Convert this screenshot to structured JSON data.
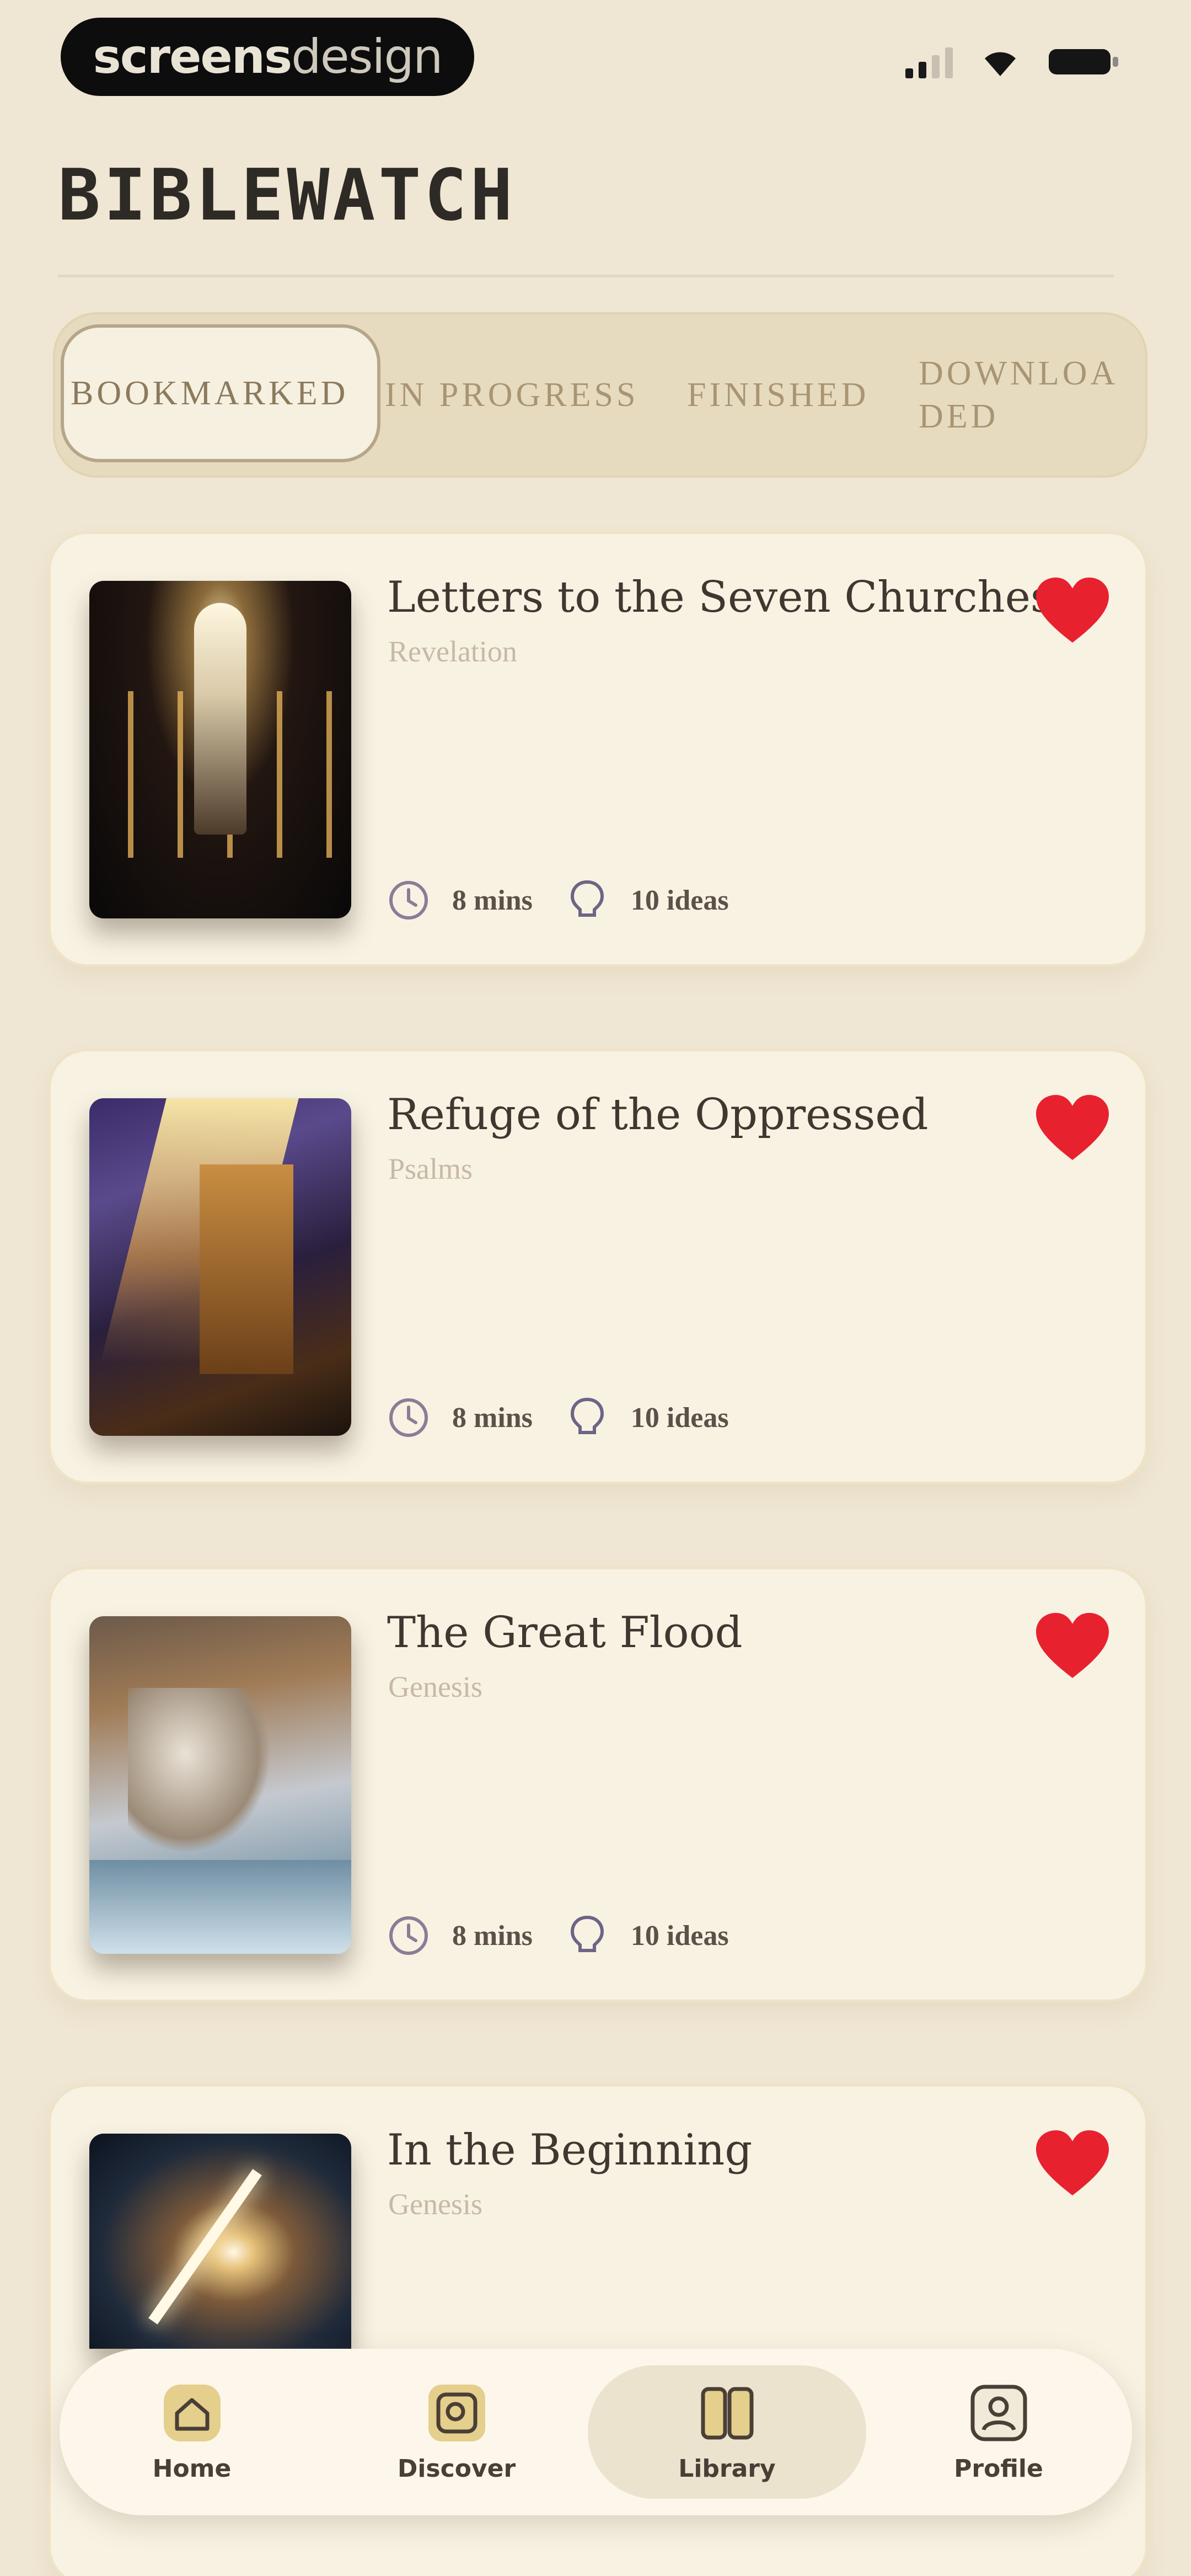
{
  "status_bar": {
    "brand_bold": "screens",
    "brand_light": "design",
    "icons": [
      "signal-icon",
      "wifi-icon",
      "battery-icon"
    ]
  },
  "header": {
    "title": "BIBLEWATCH"
  },
  "tabs": [
    {
      "label": "BOOKMARKED",
      "active": true
    },
    {
      "label": "IN PROGRESS",
      "active": false
    },
    {
      "label": "FINISHED",
      "active": false
    },
    {
      "label": "DOWNLOADED",
      "active": false
    }
  ],
  "cards": [
    {
      "title": "Letters to the Seven Churches",
      "book": "Revelation",
      "duration": "8 mins",
      "ideas": "10 ideas"
    },
    {
      "title": "Refuge of the Oppressed",
      "book": "Psalms",
      "duration": "8 mins",
      "ideas": "10 ideas"
    },
    {
      "title": "The Great Flood",
      "book": "Genesis",
      "duration": "8 mins",
      "ideas": "10 ideas"
    },
    {
      "title": "In the Beginning",
      "book": "Genesis"
    }
  ],
  "bottom_nav": [
    {
      "label": "Home",
      "icon": "home-icon",
      "active": false
    },
    {
      "label": "Discover",
      "icon": "discover-icon",
      "active": false
    },
    {
      "label": "Library",
      "icon": "library-icon",
      "active": true
    },
    {
      "label": "Profile",
      "icon": "profile-icon",
      "active": false
    }
  ],
  "colors": {
    "background": "#efe6d3",
    "card": "#f8f2e3",
    "heart": "#e8212f",
    "tab_bar": "#e7dbbf"
  }
}
